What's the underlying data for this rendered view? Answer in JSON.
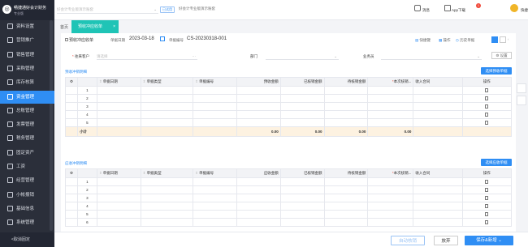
{
  "sidebar": {
    "logo_title": "畅捷通好会计财务",
    "logo_sub": "专业版",
    "items": [
      {
        "label": "资料设置"
      },
      {
        "label": "营销推广"
      },
      {
        "label": "销售管理"
      },
      {
        "label": "采购管理"
      },
      {
        "label": "库存核算"
      },
      {
        "label": "资金管理"
      },
      {
        "label": "总账管理"
      },
      {
        "label": "发票管理"
      },
      {
        "label": "税务管理"
      },
      {
        "label": "固定资产"
      },
      {
        "label": "工资"
      },
      {
        "label": "经营管理"
      },
      {
        "label": "小帐报销"
      },
      {
        "label": "基础信息"
      },
      {
        "label": "系统管理"
      }
    ],
    "active_index": 5,
    "collapse_label": "<取消固定"
  },
  "header": {
    "account_placeholder": "好会计专业版演示账套",
    "tag": "已试用",
    "tip": "好会计专业版演示账套",
    "messages_label": "消息",
    "messages_count": "1",
    "app_label": "App下载",
    "user_label": "快捷"
  },
  "tabs": {
    "home": "首页",
    "active": "预收冲应收单",
    "close": "×"
  },
  "form": {
    "doc_title": "预收冲应收单",
    "date_label": "单据日期",
    "date_value": "2023-03-18",
    "number_label": "单据编号",
    "number_value": "CS-20230318-001",
    "toolbar": [
      "快捷键",
      "操作",
      "历史单据"
    ],
    "customer_label": "往来客户",
    "customer_placeholder": "请选择",
    "dept_label": "部门",
    "salesman_label": "业务员",
    "settings_btn": "设置"
  },
  "table1": {
    "title": "预收冲销明细",
    "select_btn": "选择预收单据",
    "columns": [
      "单据日期",
      "单据类型",
      "单据编号",
      "预收金额",
      "已核销金额",
      "待核销金额",
      "本次核销...",
      "收入合同",
      "操作"
    ],
    "rows": [
      "1",
      "2",
      "3",
      "4",
      "5"
    ],
    "sum_label": "小计",
    "sums": [
      "0.00",
      "0.00",
      "0.00",
      "0.00"
    ]
  },
  "table2": {
    "title": "应收冲销明细",
    "select_btn": "选择应收单据",
    "columns": [
      "单据日期",
      "单据类型",
      "单据编号",
      "应收金额",
      "已核销金额",
      "待核销金额",
      "本次核销...",
      "收入合同",
      "操作"
    ],
    "rows": [
      "1",
      "2",
      "3",
      "4",
      "5",
      "6"
    ]
  },
  "footer": {
    "auto_btn": "自动核销",
    "discard_btn": "放弃",
    "save_btn": "保存&新增"
  },
  "colors": {
    "sidebar_bg": "#2b2f3a",
    "accent": "#2f8ef4",
    "tab_active": "#1fc4b6",
    "subtotal_bg": "#fdf2e1"
  }
}
